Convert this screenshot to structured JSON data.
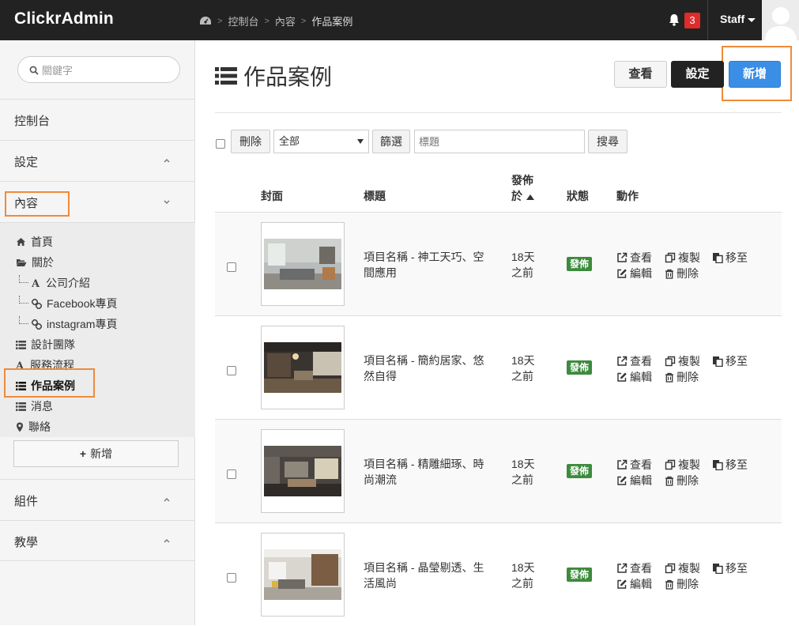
{
  "app": {
    "brand": "ClickrAdmin"
  },
  "breadcrumb": {
    "items": [
      "控制台",
      "內容",
      "作品案例"
    ]
  },
  "header": {
    "notifications": "3",
    "user": "Staff"
  },
  "sidebar": {
    "search_placeholder": "關鍵字",
    "sections": [
      "控制台",
      "設定",
      "內容",
      "組件",
      "教學"
    ],
    "items": [
      {
        "label": "首頁",
        "icon": "home-icon"
      },
      {
        "label": "關於",
        "icon": "folder-open-icon"
      },
      {
        "label": "公司介紹",
        "icon": "font-icon"
      },
      {
        "label": "Facebook專頁",
        "icon": "link-icon"
      },
      {
        "label": "instagram專頁",
        "icon": "link-icon"
      },
      {
        "label": "設計團隊",
        "icon": "list-icon"
      },
      {
        "label": "服務流程",
        "icon": "font-icon"
      },
      {
        "label": "作品案例",
        "icon": "list-icon"
      },
      {
        "label": "消息",
        "icon": "list-icon"
      },
      {
        "label": "聯絡",
        "icon": "map-marker-icon"
      }
    ],
    "add_label": "新增"
  },
  "page": {
    "title": "作品案例",
    "buttons": {
      "view": "查看",
      "settings": "設定",
      "new": "新增"
    }
  },
  "filter": {
    "delete": "刪除",
    "select_value": "全部",
    "filter": "篩選",
    "title_placeholder": "標題",
    "search": "搜尋"
  },
  "table": {
    "headers": {
      "cover": "封面",
      "title": "標題",
      "published_a": "發佈",
      "published_b": "於",
      "status": "狀態",
      "actions": "動作"
    },
    "actions": {
      "view": "查看",
      "copy": "複製",
      "move": "移至",
      "edit": "編輯",
      "delete": "刪除"
    },
    "rows": [
      {
        "title": "項目名稱 - 神工天巧、空間應用",
        "published": "18天之前",
        "status": "發佈"
      },
      {
        "title": "項目名稱 - 簡約居家、悠然自得",
        "published": "18天之前",
        "status": "發佈"
      },
      {
        "title": "項目名稱 - 精雕細琢、時尚潮流",
        "published": "18天之前",
        "status": "發佈"
      },
      {
        "title": "項目名稱 - 晶瑩剔透、生活風尚",
        "published": "18天之前",
        "status": "發佈"
      }
    ]
  },
  "colors": {
    "topbar": "#222222",
    "primary": "#3a8ee6",
    "success": "#3d8b3d",
    "danger": "#e02b2b",
    "highlight": "#ee8b3a"
  }
}
